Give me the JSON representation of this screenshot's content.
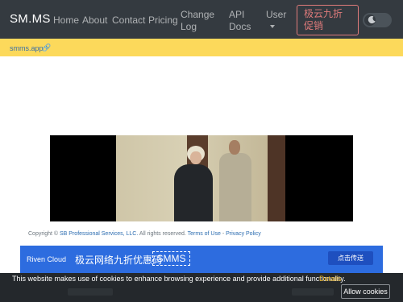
{
  "navbar": {
    "brand": "SM.MS",
    "links": {
      "home": "Home",
      "about": "About",
      "contact": "Contact",
      "pricing": "Pricing",
      "changelog": "Change Log",
      "api_docs": "API Docs",
      "user": "User"
    },
    "promo_button": "极云九折促销",
    "theme_toggle_icon": "moon-icon"
  },
  "notice": {
    "link_text": "smms.app",
    "link_icon": "link-icon"
  },
  "footer": {
    "copyright_prefix": "Copyright ©",
    "company": "SB Professional Services, LLC.",
    "rights": "All rights reserved.",
    "terms": "Terms of Use",
    "separator": "-",
    "privacy": "Privacy Policy"
  },
  "ad": {
    "brand": "Riven Cloud",
    "text": "极云网络九折优惠码",
    "code": "SMMS",
    "button": "点击传送"
  },
  "cookie": {
    "message": "This website makes use of cookies to enhance browsing experience and provide additional functionality.",
    "details": "Details",
    "allow": "Allow cookies"
  },
  "colors": {
    "navbar": "#343a40",
    "notice": "#fcd95b",
    "promo": "#e07b7b",
    "ad": "#2d6cdf",
    "cookie": "#24282c",
    "details": "#d4a017"
  }
}
